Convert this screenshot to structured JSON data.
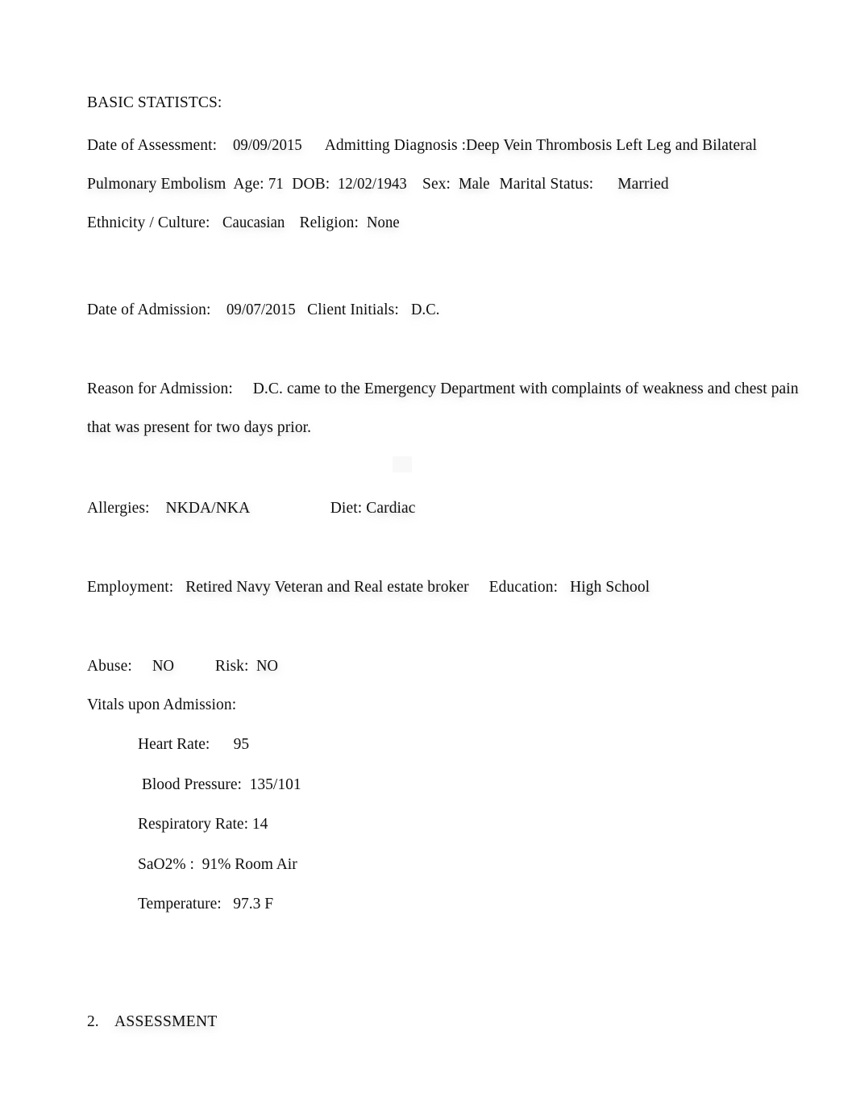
{
  "document": {
    "heading": "BASIC STATISTCS:",
    "basic_statistics": {
      "date_of_assessment_label": "Date of Assessment:",
      "date_of_assessment_value": "09/09/2015",
      "admitting_diagnosis_label": "Admitting Diagnosis",
      "admitting_diagnosis_sep": ":",
      "admitting_diagnosis_value": "Deep Vein Thrombosis Left Leg and Bilateral Pulmonary Embolism",
      "age_label": "Age:",
      "age_value": "71",
      "dob_label": "DOB:",
      "dob_value": "12/02/1943",
      "sex_label": "Sex:",
      "sex_value": "Male",
      "marital_status_label": "Marital Status:",
      "marital_status_value": "Married",
      "ethnicity_label": "Ethnicity / Culture:",
      "ethnicity_value": "Caucasian",
      "religion_label": "Religion:",
      "religion_value": "None"
    },
    "admission": {
      "date_of_admission_label": "Date of Admission:",
      "date_of_admission_value": "09/07/2015",
      "client_initials_label": "Client Initials:",
      "client_initials_value": "D.C."
    },
    "reason_for_admission": {
      "label": "Reason for Admission:",
      "value": "D.C. came to the Emergency Department with complaints of weakness and chest pain that was present for two days prior."
    },
    "allergies": {
      "allergies_label": "Allergies:",
      "allergies_value": "NKDA/NKA",
      "diet_label": "Diet:",
      "diet_value": "Cardiac"
    },
    "background": {
      "employment_label": "Employment:",
      "employment_value": "Retired Navy Veteran and Real estate broker",
      "education_label": "Education:",
      "education_value": "High School"
    },
    "risk": {
      "abuse_label": "Abuse:",
      "abuse_value": "NO",
      "risk_label": "Risk:",
      "risk_value": "NO"
    },
    "vitals": {
      "heading": "Vitals upon Admission:",
      "items": [
        {
          "label": "Heart Rate:",
          "value": "95",
          "gap": "      "
        },
        {
          "label": " Blood Pressure:",
          "value": "135/101",
          "gap": "  "
        },
        {
          "label": "Respiratory Rate:",
          "value": "14",
          "gap": " "
        },
        {
          "label": "SaO2% :",
          "value": "91% Room Air",
          "gap": "  "
        },
        {
          "label": "Temperature:",
          "value": "97.3 F",
          "gap": "   "
        }
      ]
    },
    "section": {
      "number": "2.",
      "label": "ASSESSMENT"
    }
  }
}
